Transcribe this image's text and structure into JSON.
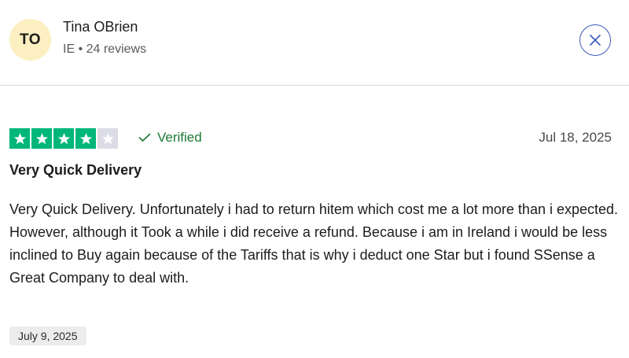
{
  "reviewer": {
    "initials": "TO",
    "name": "Tina OBrien",
    "meta": "IE • 24 reviews",
    "avatar_color": "#fcefc1"
  },
  "close_icon": "close-icon",
  "review": {
    "rating": 4,
    "max_rating": 5,
    "star_color": "#00b67a",
    "verified_label": "Verified",
    "verified_color": "#1b7a34",
    "date": "Jul 18, 2025",
    "title": "Very Quick Delivery",
    "body": "Very Quick Delivery. Unfortunately i had to return hitem which cost me a lot more than i expected. However, although it Took a while i did receive a refund. Because i am in Ireland i would be less inclined to Buy again because of the Tariffs that is why i deduct one Star but i found SSense a Great Company to deal with.",
    "experience_date": "July 9, 2025"
  }
}
